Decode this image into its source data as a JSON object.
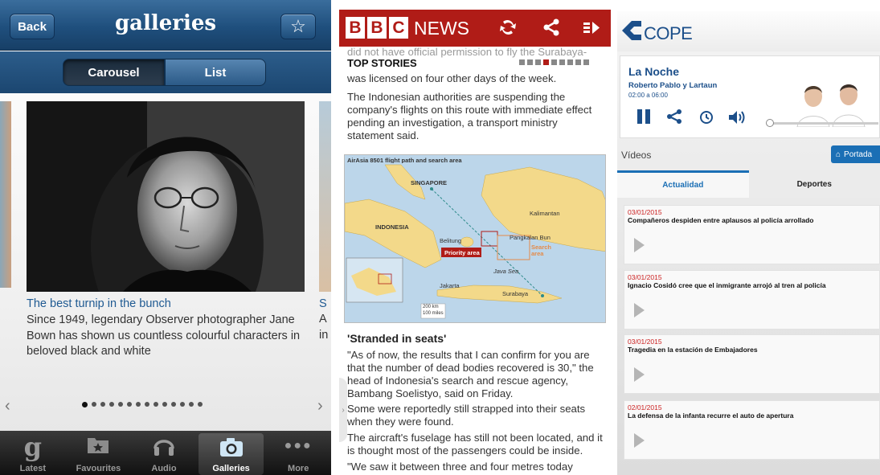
{
  "guardian": {
    "back_label": "Back",
    "title": "galleries",
    "segments": {
      "carousel": "Carousel",
      "list": "List"
    },
    "caption": {
      "title": "The best turnip in the bunch",
      "body": "Since 1949, legendary Observer photographer Jane Bown has shown us countless colourful characters in beloved black and white"
    },
    "next_caption": {
      "title": "S",
      "line1": "A",
      "line2": "in"
    },
    "page_dots": 14,
    "active_dot": 0,
    "tabs": [
      {
        "label": "Latest",
        "icon": "guardian-g-icon"
      },
      {
        "label": "Favourites",
        "icon": "folder-star-icon"
      },
      {
        "label": "Audio",
        "icon": "headphones-icon"
      },
      {
        "label": "Galleries",
        "icon": "camera-icon",
        "active": true
      },
      {
        "label": "More",
        "icon": "more-dots-icon"
      }
    ]
  },
  "bbc": {
    "logo_letters": [
      "B",
      "B",
      "C"
    ],
    "news_label": "NEWS",
    "clipped_text": "did not have official permission to fly the Surabaya-Singapore route on Sunday - the day of the crash - but",
    "top_stories": "TOP STORIES",
    "paragraphs": [
      "was licensed on four other days of the week.",
      "The Indonesian authorities are suspending the company's flights on this route with immediate effect pending an investigation, a transport ministry statement said."
    ],
    "map": {
      "title": "AirAsia 8501 flight path and search area",
      "labels": {
        "singapore": "SINGAPORE",
        "indonesia": "INDONESIA",
        "kalimantan": "Kalimantan",
        "belitung": "Belitung",
        "pangkalan": "Pangkalan Bun",
        "priority": "Priority area",
        "search": "Search area",
        "java_sea": "Java Sea",
        "jakarta": "Jakarta",
        "surabaya": "Surabaya",
        "scale_km": "200 km",
        "scale_mi": "100 miles"
      }
    },
    "heading": "'Stranded in seats'",
    "body": [
      "\"As of now, the results that I can confirm for you are that the number of dead bodies recovered is 30,\" the head of Indonesia's search and rescue agency, Bambang Soelistyo, said on Friday.",
      "Some were reportedly still strapped into their seats when they were found.",
      "The aircraft's fuselage has still not been located, and it is thought most of the passengers could be inside.",
      "\"We saw it between three and four metres today"
    ],
    "colors": {
      "brand": "#b01c17"
    }
  },
  "cope": {
    "logo": "COPE",
    "program": {
      "title": "La Noche",
      "hosts": "Roberto Pablo y Lartaun",
      "time": "02:00 a 06:00"
    },
    "section": "Vídeos",
    "portada": "Portada",
    "tabs": [
      "Actualidad",
      "Deportes"
    ],
    "items": [
      {
        "date": "03/01/2015",
        "title": "Compañeros despiden entre aplausos al policía arrollado"
      },
      {
        "date": "03/01/2015",
        "title": "Ignacio Cosidó cree que el inmigrante arrojó al tren al policía"
      },
      {
        "date": "03/01/2015",
        "title": "Tragedia en la estación de Embajadores"
      },
      {
        "date": "02/01/2015",
        "title": "La defensa de la infanta recurre el auto de apertura"
      }
    ],
    "colors": {
      "brand": "#1c4f8a",
      "accent": "#1b6fb5"
    }
  }
}
